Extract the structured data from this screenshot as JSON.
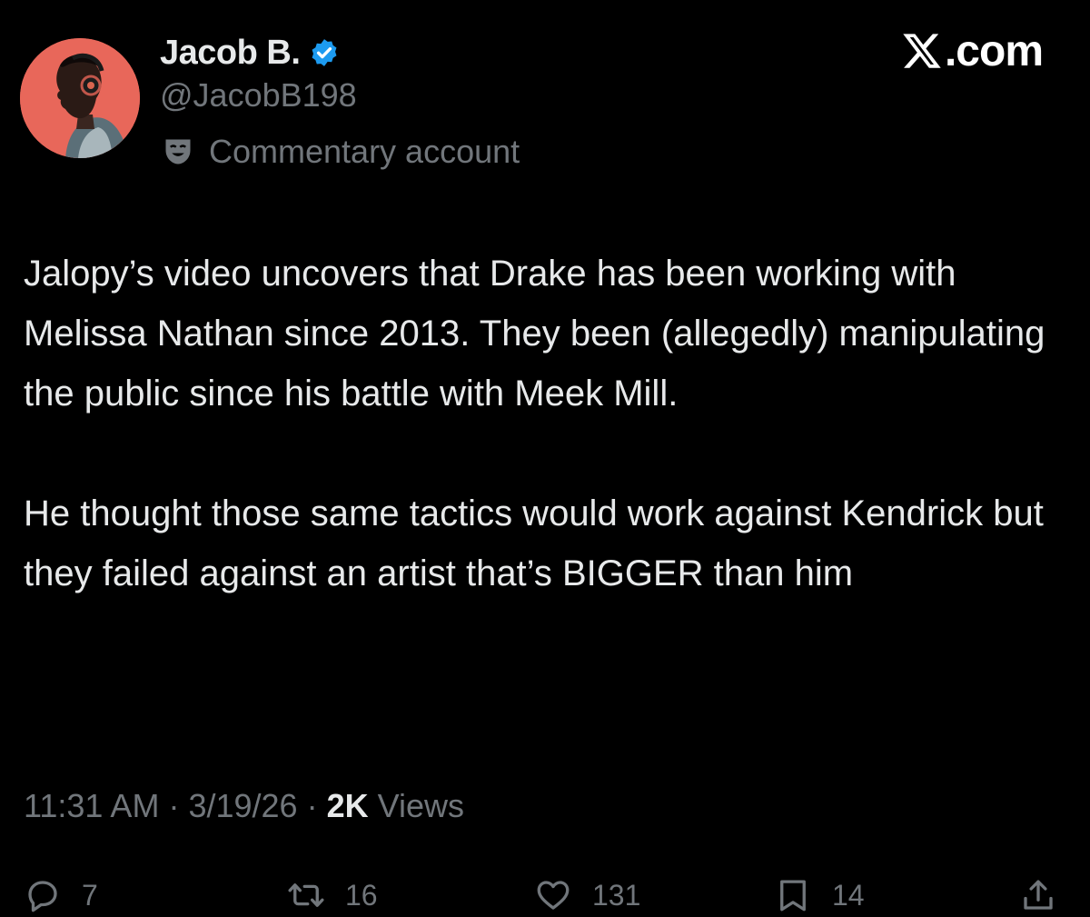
{
  "author": {
    "display_name": "Jacob B.",
    "handle": "@JacobB198",
    "verified": true,
    "account_label": "Commentary account",
    "avatar_color": "#e8675a"
  },
  "brand": {
    "text": ".com",
    "icon": "x-logo-icon"
  },
  "tweet": {
    "paragraphs": [
      "Jalopy’s video uncovers that Drake has been working with Melissa Nathan since 2013. They been (allegedly) manipulating the public since his battle with Meek Mill.",
      "He thought those same tactics would work against Kendrick but they failed against an artist that’s BIGGER than him"
    ],
    "time": "11:31 AM",
    "date": "3/19/26",
    "views_count": "2K",
    "views_label": "Views"
  },
  "actions": {
    "replies": "7",
    "reposts": "16",
    "likes": "131",
    "bookmarks": "14",
    "share_icon": "share-icon"
  },
  "colors": {
    "background": "#000000",
    "primary_text": "#e7e9ea",
    "secondary_text": "#71767b",
    "verified_blue": "#1d9bf0"
  }
}
